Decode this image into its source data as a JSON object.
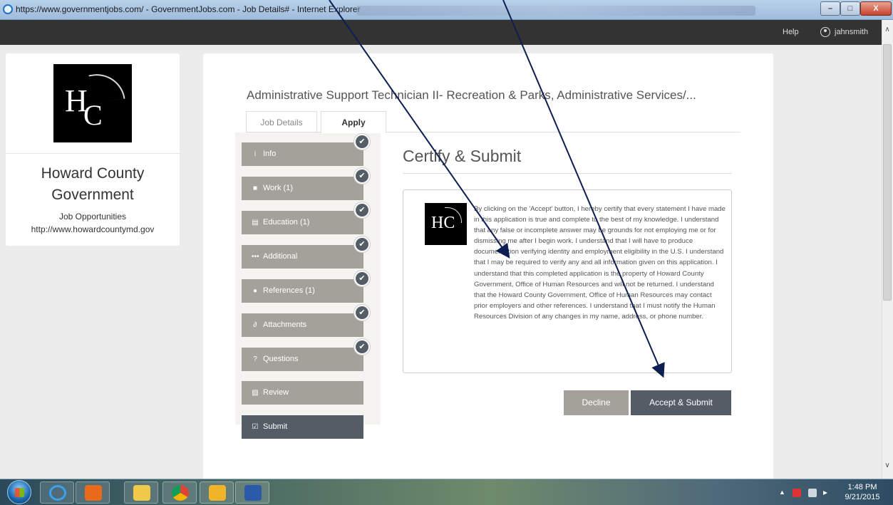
{
  "window": {
    "title": "https://www.governmentjobs.com/ - GovernmentJobs.com - Job Details# - Internet Explorer",
    "min_label": "–",
    "max_label": "□",
    "close_label": "X"
  },
  "topnav": {
    "help": "Help",
    "username": "jahnsmith"
  },
  "org": {
    "logo_monogram": "H",
    "logo_monogram_c": "C",
    "name_line1": "Howard County",
    "name_line2": "Government",
    "subtitle": "Job Opportunities",
    "url": "http://www.howardcountymd.gov"
  },
  "job": {
    "title": "Administrative Support Technician II- Recreation & Parks, Administrative Services/..."
  },
  "tabs": [
    {
      "label": "Job Details",
      "active": false
    },
    {
      "label": "Apply",
      "active": true
    }
  ],
  "steps": [
    {
      "label": "Info",
      "icon": "info-icon",
      "glyph": "i",
      "completed": true
    },
    {
      "label": "Work (1)",
      "icon": "briefcase-icon",
      "glyph": "■",
      "completed": true
    },
    {
      "label": "Education (1)",
      "icon": "book-icon",
      "glyph": "▤",
      "completed": true
    },
    {
      "label": "Additional",
      "icon": "ellipsis-icon",
      "glyph": "•••",
      "completed": true
    },
    {
      "label": "References (1)",
      "icon": "speech-bubble-icon",
      "glyph": "●",
      "completed": true
    },
    {
      "label": "Attachments",
      "icon": "paperclip-icon",
      "glyph": "∂",
      "completed": true
    },
    {
      "label": "Questions",
      "icon": "question-icon",
      "glyph": "?",
      "completed": true
    },
    {
      "label": "Review",
      "icon": "review-icon",
      "glyph": "▧",
      "completed": false
    },
    {
      "label": "Submit",
      "icon": "submit-icon",
      "glyph": "☑",
      "completed": false,
      "active": true
    }
  ],
  "certify": {
    "heading": "Certify & Submit",
    "text": "By clicking on the 'Accept' button, I hereby certify that every statement I have made in this application is true and complete to the best of my knowledge. I understand that any false or incomplete answer may be grounds for not employing me or for dismissing me after I begin work. I understand that I will have to produce documentation verifying identity and employment eligibility in the U.S. I understand that I may be required to verify any and all information given on this application. I understand that this completed application is the property of Howard County Government, Office of Human Resources and will not be returned. I understand that the Howard County Government, Office of Human Resources may contact prior employers and other references. I understand that I must notify the Human Resources Division of any changes in my name, address, or phone number.",
    "decline_label": "Decline",
    "accept_label": "Accept & Submit"
  },
  "taskbar": {
    "time": "1:48 PM",
    "date": "9/21/2015",
    "items": [
      "internet-explorer",
      "media-player",
      "file-explorer",
      "chrome",
      "outlook",
      "word"
    ]
  },
  "colors": {
    "step_completed": "#a3a19a",
    "step_active": "#545d65",
    "accent_dark": "#545d65",
    "topbar": "#333333"
  }
}
